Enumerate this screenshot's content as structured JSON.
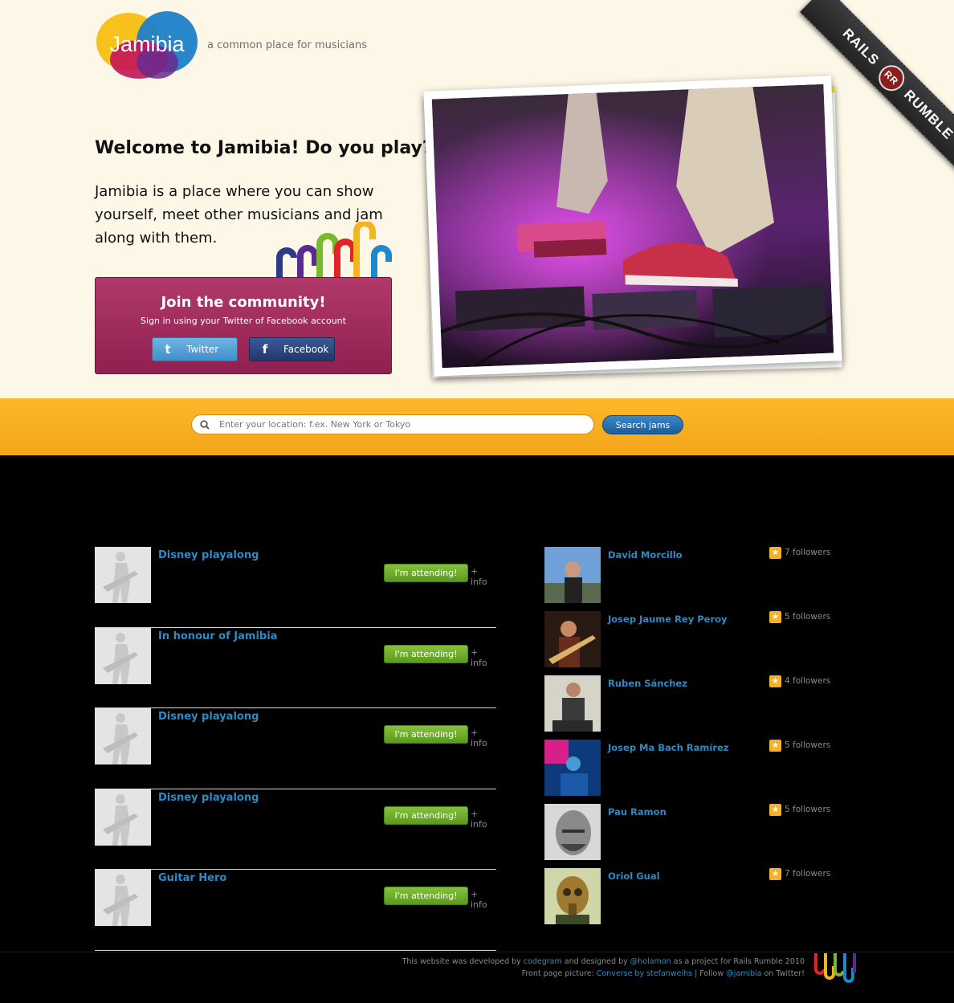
{
  "header": {
    "logo_text": "Jamibia",
    "tagline": "a common place for musicians",
    "ribbon_left": "RAILS",
    "ribbon_badge": "RR",
    "ribbon_right": "RUMBLE"
  },
  "welcome": {
    "title": "Welcome to Jamibia! Do you play?",
    "text": "Jamibia is a place where you can show yourself, meet other musicians and jam along with them."
  },
  "join": {
    "title": "Join the community!",
    "subtitle": "Sign in using your Twitter of Facebook account",
    "twitter_label": "Twitter",
    "facebook_label": "Facebook"
  },
  "search": {
    "placeholder": "Enter your location: f.ex. New York or Tokyo",
    "button_label": "Search jams"
  },
  "jams": [
    {
      "title": "Disney playalong",
      "attend_label": "I'm attending!",
      "info_label": "+ info"
    },
    {
      "title": "In honour of Jamibia",
      "attend_label": "I'm attending!",
      "info_label": "+ info"
    },
    {
      "title": "Disney playalong",
      "attend_label": "I'm attending!",
      "info_label": "+ info"
    },
    {
      "title": "Disney playalong",
      "attend_label": "I'm attending!",
      "info_label": "+ info"
    },
    {
      "title": "Guitar Hero",
      "attend_label": "I'm attending!",
      "info_label": "+ info"
    }
  ],
  "musicians": [
    {
      "name": "David Morcillo",
      "followers": "7 followers"
    },
    {
      "name": "Josep Jaume Rey Peroy",
      "followers": "5 followers"
    },
    {
      "name": "Ruben Sánchez",
      "followers": "4 followers"
    },
    {
      "name": "Josep Ma Bach Ramírez",
      "followers": "5 followers"
    },
    {
      "name": "Pau Ramon",
      "followers": "5 followers"
    },
    {
      "name": "Oriol Gual",
      "followers": "7 followers"
    }
  ],
  "footer": {
    "line1_a": "This website was developed by ",
    "line1_link1": "codegram",
    "line1_b": " and designed by ",
    "line1_link2": "@holamon",
    "line1_c": " as a project for Rails Rumble 2010",
    "line2_a": "Front page picture: ",
    "line2_link1": "Converse by stefanweihs",
    "line2_b": " | Follow ",
    "line2_link2": "@jamibia",
    "line2_c": " on Twitter!"
  },
  "colors": {
    "background_top": "#fdf7e8",
    "accent_blue": "#2b8bc7",
    "join_magenta": "#a02e5f",
    "search_band": "#f8ad22",
    "attend_green": "#6fae2b"
  }
}
